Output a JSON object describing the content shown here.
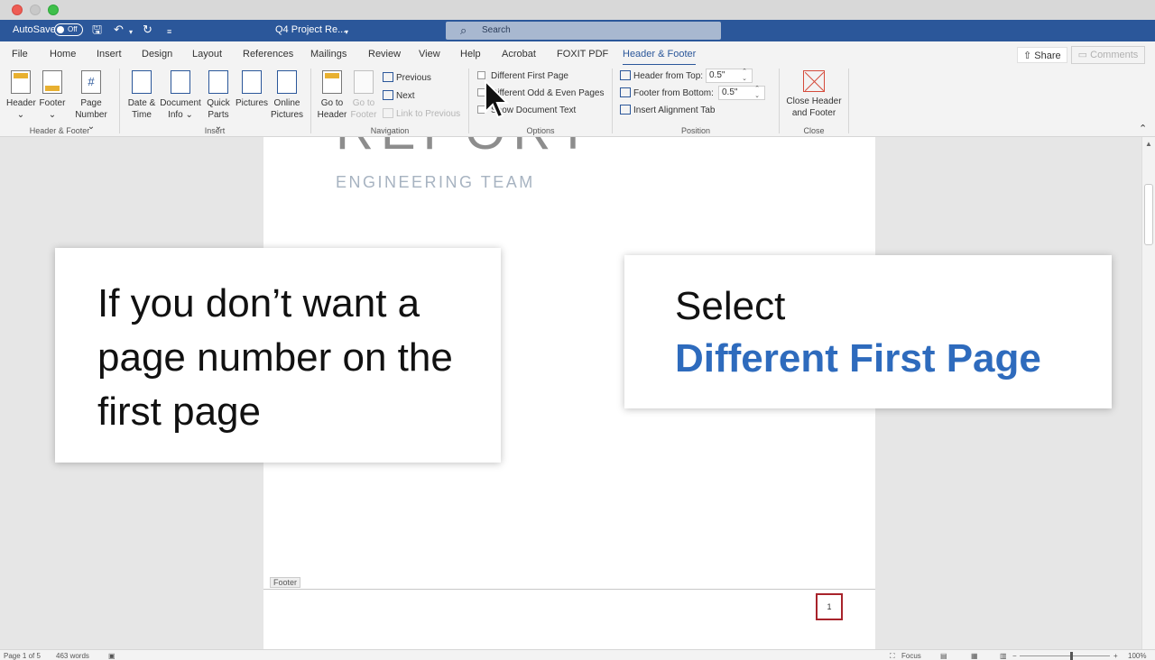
{
  "window": {
    "autosave_label": "AutoSave",
    "autosave_state": "Off",
    "document_title": "Q4 Project Re...",
    "search_placeholder": "Search"
  },
  "menu_tabs": [
    "File",
    "Home",
    "Insert",
    "Design",
    "Layout",
    "References",
    "Mailings",
    "Review",
    "View",
    "Help",
    "Acrobat",
    "FOXIT PDF",
    "Header & Footer"
  ],
  "active_tab": "Header & Footer",
  "share_label": "Share",
  "comments_label": "Comments",
  "ribbon": {
    "header_footer_group": {
      "label": "Header & Footer",
      "header": "Header",
      "footer": "Footer",
      "page_number_line1": "Page",
      "page_number_line2": "Number"
    },
    "insert_group": {
      "label": "Insert",
      "date_time_line1": "Date &",
      "date_time_line2": "Time",
      "doc_info_line1": "Document",
      "doc_info_line2": "Info",
      "quick_parts_line1": "Quick",
      "quick_parts_line2": "Parts",
      "pictures": "Pictures",
      "online_pictures_line1": "Online",
      "online_pictures_line2": "Pictures"
    },
    "navigation_group": {
      "label": "Navigation",
      "goto_header_line1": "Go to",
      "goto_header_line2": "Header",
      "goto_footer_line1": "Go to",
      "goto_footer_line2": "Footer",
      "previous": "Previous",
      "next": "Next",
      "link_to_previous": "Link to Previous"
    },
    "options_group": {
      "label": "Options",
      "different_first_page": "Different First Page",
      "different_odd_even": "Different Odd & Even Pages",
      "show_document_text": "Show Document Text"
    },
    "position_group": {
      "label": "Position",
      "header_from_top_label": "Header from Top:",
      "header_from_top_value": "0.5\"",
      "footer_from_bottom_label": "Footer from Bottom:",
      "footer_from_bottom_value": "0.5\"",
      "insert_alignment_tab": "Insert Alignment Tab"
    },
    "close_group": {
      "label": "Close",
      "close_line1": "Close Header",
      "close_line2": "and Footer"
    }
  },
  "document": {
    "title_partial": "REPORT",
    "subtitle": "ENGINEERING TEAM",
    "footer_tag": "Footer",
    "page_number": "1"
  },
  "callouts": {
    "left_text": "If you don’t want a page number on the first page",
    "right_line1": "Select",
    "right_line2": "Different First Page",
    "highlight_color": "#2e6bbd"
  },
  "status": {
    "page": "Page 1 of 5",
    "words": "463 words",
    "focus": "Focus",
    "zoom": "100%"
  }
}
